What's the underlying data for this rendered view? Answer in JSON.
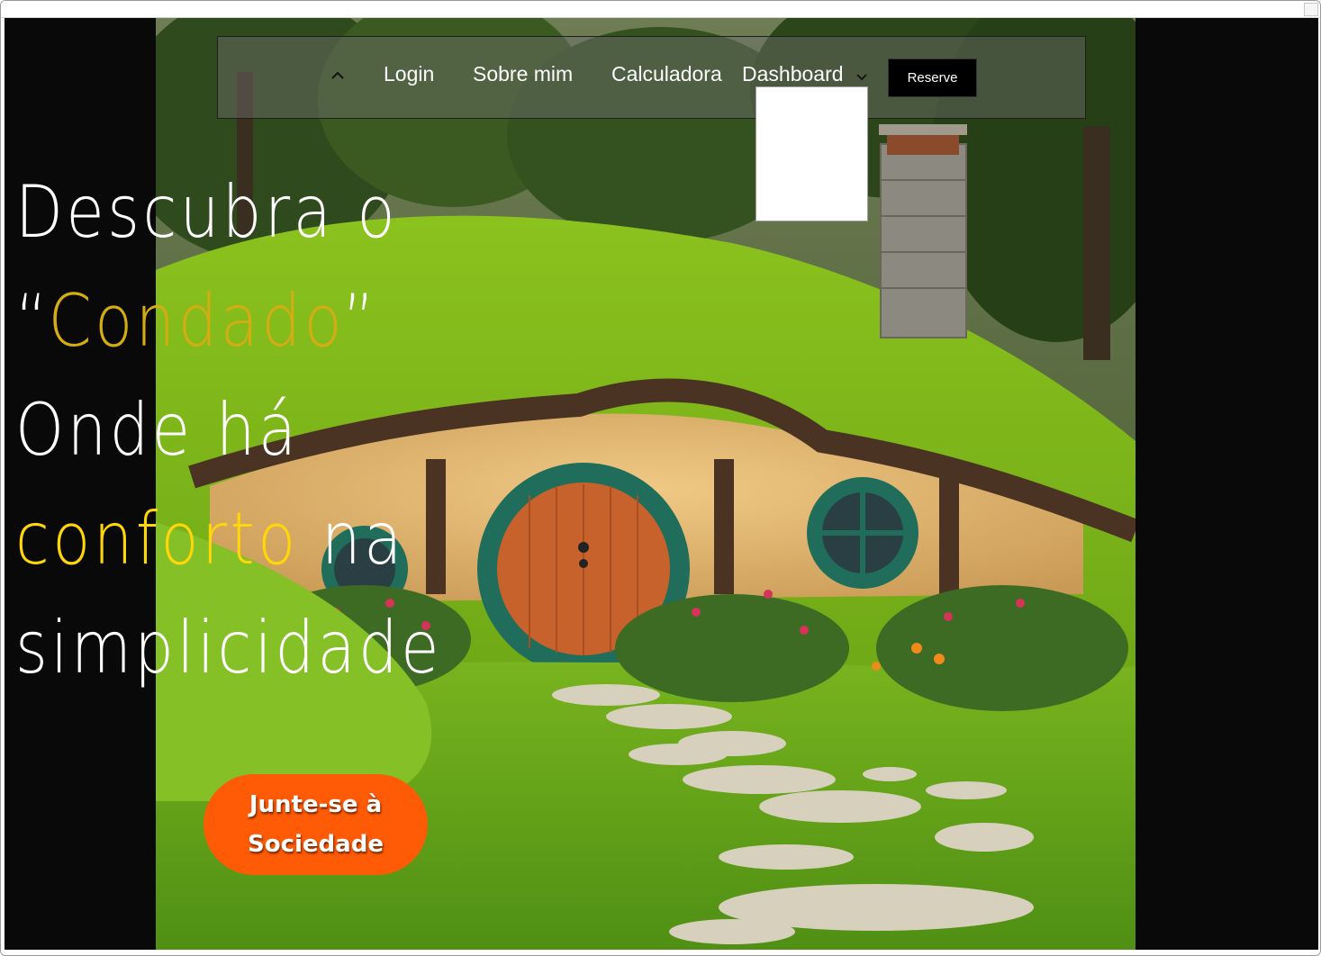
{
  "navbar": {
    "items": [
      {
        "label": "Login"
      },
      {
        "label": "Sobre  mim"
      },
      {
        "label": "Calculadora"
      },
      {
        "label": "Dashboard"
      }
    ],
    "reserve_label": "Reserve"
  },
  "hero": {
    "line1": "Descubra o",
    "line2_open_quote": "“",
    "line2_word": "Condado",
    "line2_close_quote": "”",
    "line3": "Onde há",
    "line4_word": "conforto",
    "line4_rest": " na",
    "line5": "simplicidade"
  },
  "cta": {
    "line1": "Junte-se à",
    "line2": "Sociedade"
  },
  "colors": {
    "accent_gold": "#d4ad12",
    "accent_yellow": "#ffd60a",
    "cta_orange": "#ff5a06",
    "page_background": "#090909"
  },
  "icons": {
    "nav_toggle": "chevron-up-icon",
    "dashboard_dropdown": "chevron-down-icon"
  }
}
